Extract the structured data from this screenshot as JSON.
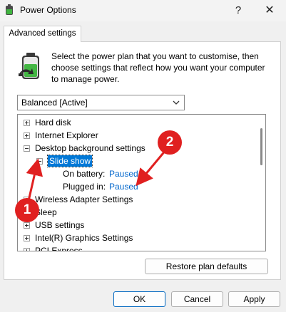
{
  "window": {
    "title": "Power Options",
    "help_glyph": "?",
    "close_glyph": "✕"
  },
  "tabs": [
    {
      "label": "Advanced settings",
      "selected": true
    }
  ],
  "intro": {
    "text": "Select the power plan that you want to customise, then choose settings that reflect how you want your computer to manage power."
  },
  "plan_select": {
    "value": "Balanced [Active]"
  },
  "tree": {
    "items": [
      {
        "label": "Hard disk",
        "toggle": "+"
      },
      {
        "label": "Internet Explorer",
        "toggle": "+"
      },
      {
        "label": "Desktop background settings",
        "toggle": "-"
      },
      {
        "label": "Slide show",
        "toggle": "-",
        "selected": true
      },
      {
        "label": "On battery:",
        "value": "Paused"
      },
      {
        "label": "Plugged in:",
        "value": "Paused"
      },
      {
        "label": "Wireless Adapter Settings",
        "toggle": "+"
      },
      {
        "label": "Sleep",
        "toggle": "+"
      },
      {
        "label": "USB settings",
        "toggle": "+"
      },
      {
        "label": "Intel(R) Graphics Settings",
        "toggle": "+"
      },
      {
        "label": "PCI Express",
        "toggle": "+"
      }
    ]
  },
  "buttons": {
    "restore": "Restore plan defaults",
    "ok": "OK",
    "cancel": "Cancel",
    "apply": "Apply"
  },
  "annotations": [
    {
      "number": "1"
    },
    {
      "number": "2"
    }
  ],
  "colors": {
    "annotation_red": "#e02020",
    "selection_blue": "#0078d7",
    "value_link_blue": "#0066cc"
  }
}
